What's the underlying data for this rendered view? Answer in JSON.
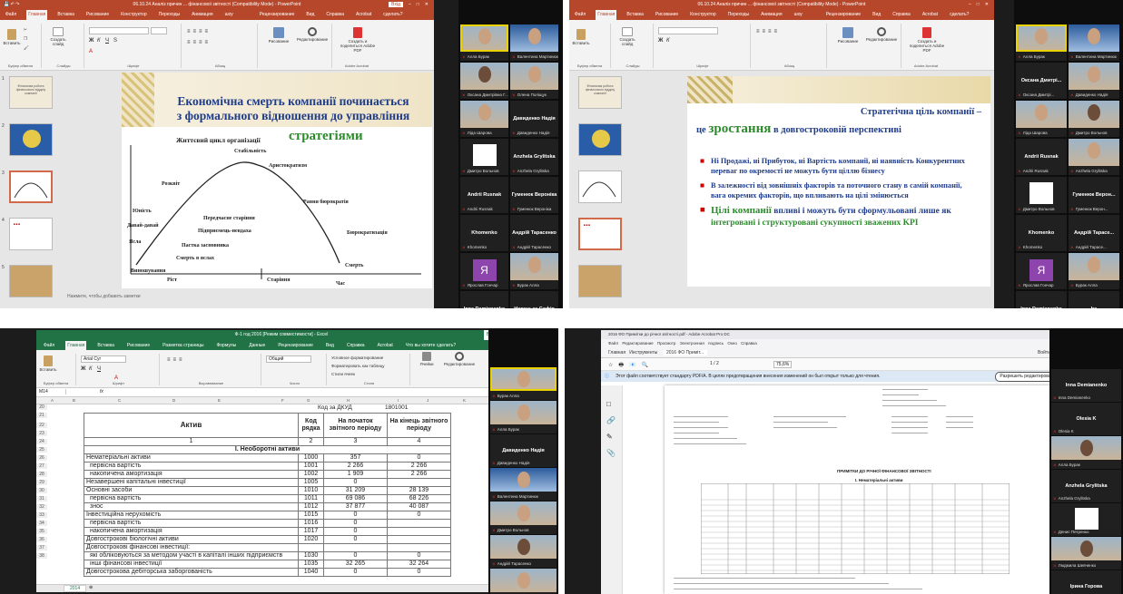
{
  "q1": {
    "title": "06.10.24 Аналіз причин ... фінансової звітності (Compatibility Mode) - PowerPoint",
    "account": "Вхід",
    "tabs": [
      "Файл",
      "Главная",
      "Вставка",
      "Рисование",
      "Конструктор",
      "Переходы",
      "Анимация",
      "Слайд-шоу",
      "Рецензирование",
      "Вид",
      "Справка",
      "Acrobat",
      "Что вы хотите сделать?"
    ],
    "share": "Поделиться",
    "ribbon": {
      "paste": "Вставить",
      "create": "Создать слайд",
      "drawing": "Рисование",
      "editing": "Редактирование",
      "adobe": "Создать и поделиться Adobe PDF",
      "groups": [
        "Буфер обмена",
        "Слайды",
        "Шрифт",
        "Абзац",
        "Adobe Acrobat"
      ]
    },
    "slide": {
      "title_line1": "Економічна смерть компанії починається",
      "title_line2": "з формального відношення до управління",
      "title_emph": "стратегіями",
      "chart_title": "Життєвий цикл організації",
      "labels": {
        "stability": "Стабільність",
        "aristocracy": "Аристократизм",
        "prosperity": "Розквіт",
        "early_bureau": "Рання бюрократія",
        "youth": "Юність",
        "pre_aging": "Передчасне старіння",
        "family_trap": "Підприємець-невдаха",
        "go_go": "Давай-давай",
        "infancy": "Ясла",
        "founder_trap": "Пастка засновника",
        "death_infancy": "Смерть в яслах",
        "bureaucracy": "Бюрократизація",
        "courtship": "Виношування",
        "death": "Смерть",
        "growth": "Ріст",
        "aging": "Старіння",
        "time": "Час"
      }
    },
    "notes": "Нажмите, чтобы добавить заметки",
    "thumb_nums": [
      "1",
      "2",
      "3",
      "4",
      "5"
    ],
    "thumb1": "Фінансова робота фінансового відділу компанії",
    "participants": [
      {
        "name": "Алла Бурак",
        "kind": "photo"
      },
      {
        "name": "Валентина Мартинюк",
        "kind": "photo-blue"
      },
      {
        "name": "Оксана Дмитрівна Г...",
        "kind": "photo"
      },
      {
        "name": "Олена Поліщук",
        "kind": "photo"
      },
      {
        "name": "Ліда Шарова",
        "kind": "photo"
      },
      {
        "name": "Давиденко Надія",
        "kind": "text"
      },
      {
        "name": "Дмитро Вольнов",
        "kind": "white"
      },
      {
        "name": "Anzhela Grylitska",
        "kind": "text"
      },
      {
        "name": "Andrii Rusnak",
        "kind": "text"
      },
      {
        "name": "Гуменюк Вероніка",
        "kind": "text"
      },
      {
        "name": "Khomenko",
        "kind": "text"
      },
      {
        "name": "Андрій Тарасенко",
        "kind": "text"
      },
      {
        "name": "Ярослав Гончар",
        "kind": "yavatar",
        "letter": "Я"
      },
      {
        "name": "Бурак Алла",
        "kind": "photo"
      },
      {
        "name": "Inna Demianenko",
        "kind": "text"
      },
      {
        "name": "Невецька Софія",
        "kind": "text"
      }
    ]
  },
  "q2": {
    "tabs": [
      "Файл",
      "Главная",
      "Вставка",
      "Рисование",
      "Конструктор",
      "Переходы",
      "Анимация",
      "Слайд-шоу",
      "Рецензирование",
      "Вид",
      "Справка",
      "Acrobat",
      "Что вы хотите сделать?"
    ],
    "share": "Поделиться",
    "slide": {
      "title_a": "Стратегічна ціль компанії –",
      "title_b": "це",
      "title_emph": "зростання",
      "title_c": "в довгостроковій перспективі",
      "bullet1": "Ні Продажі, ні Прибуток, ні Вартість компанії, ні наявність Конкурентних переваг по окремості не можуть бути ціллю бізнесу",
      "bullet2": "В залежності від зовнішніх факторів та поточного стану в самій компанії, вага окремих факторів, що впливають на цілі змінюється",
      "bullet3_emph": "Цілі компанії",
      "bullet3_a": "впливі і можуть бути сформульовані лише як",
      "bullet3_emph2": "інтегровані і структуровані сукупності зважених KPI"
    },
    "participants": [
      {
        "name": "Алла Бурак",
        "kind": "photo"
      },
      {
        "name": "Валентина Мартинюк",
        "kind": "photo-blue"
      },
      {
        "name": "Оксана Дмитрі...",
        "kind": "text"
      },
      {
        "name": "Давиденко Надія",
        "kind": "photo"
      },
      {
        "name": "Ліда Шарова",
        "kind": "photo"
      },
      {
        "name": "Дмитро Вольнов",
        "kind": "photo"
      },
      {
        "name": "Andrii Rusnak",
        "kind": "text"
      },
      {
        "name": "Anzhela Grylitska",
        "kind": "photo"
      },
      {
        "name": "Дмитро Вольнов",
        "kind": "white"
      },
      {
        "name": "Гуменюк Верон...",
        "kind": "text"
      },
      {
        "name": "Khomenko",
        "kind": "text"
      },
      {
        "name": "Андрій Тарасе...",
        "kind": "text"
      },
      {
        "name": "Ярослав Гончар",
        "kind": "yavatar",
        "letter": "Я"
      },
      {
        "name": "Бурак Алла",
        "kind": "photo"
      },
      {
        "name": "Inna Demianenko",
        "kind": "text"
      },
      {
        "name": "Ira",
        "kind": "text"
      }
    ]
  },
  "q3": {
    "title": "Ф-1 год 2016 [Режим совместимости] - Excel",
    "account": "Вход",
    "tabs": [
      "Файл",
      "Главная",
      "Вставка",
      "Рисование",
      "Разметка страницы",
      "Формулы",
      "Данные",
      "Рецензирование",
      "Вид",
      "Справка",
      "Acrobat",
      "Что вы хотите сделать?"
    ],
    "cellref": "M14",
    "fx": "fx",
    "font": "Arial Cyr",
    "numfmt": "Общий",
    "ribbon": {
      "paste": "Вставить",
      "cond": "Условное форматирование",
      "astable": "Форматировать как таблицу",
      "styles": "Стили ячеек",
      "cells": "Ячейки",
      "editing": "Редактирование",
      "groups": [
        "Буфер обмена",
        "Шрифт",
        "Выравнивание",
        "Число",
        "Стили"
      ]
    },
    "col_letters": [
      "A",
      "B",
      "C",
      "D",
      "E",
      "F",
      "G",
      "H",
      "I",
      "J",
      "K",
      "L"
    ],
    "code_dkud_label": "Код за ДКУД",
    "code_dkud": "1801001",
    "headers": [
      "Актив",
      "Код рядка",
      "На початок звітного періоду",
      "На кінець звітного періоду"
    ],
    "index_row": [
      "1",
      "2",
      "3",
      "4"
    ],
    "section": "I. Необоротні активи",
    "rows": [
      {
        "rn": "24",
        "name": "Нематеріальні активи",
        "code": "1000",
        "start": "357",
        "end": "0"
      },
      {
        "rn": "25",
        "name": "первісна вартість",
        "code": "1001",
        "start": "2 266",
        "end": "2 266"
      },
      {
        "rn": "26",
        "name": "накопичена амортизація",
        "code": "1002",
        "start": "1 909",
        "end": "2 266"
      },
      {
        "rn": "27",
        "name": "Незавершені капітальні інвестиції",
        "code": "1005",
        "start": "0",
        "end": ""
      },
      {
        "rn": "28",
        "name": "Основні засоби",
        "code": "1010",
        "start": "31 209",
        "end": "28 139"
      },
      {
        "rn": "29",
        "name": "первісна вартість",
        "code": "1011",
        "start": "69 086",
        "end": "68 226"
      },
      {
        "rn": "30",
        "name": "знос",
        "code": "1012",
        "start": "37 877",
        "end": "40 087"
      },
      {
        "rn": "31",
        "name": "Інвестиційна нерухомість",
        "code": "1015",
        "start": "0",
        "end": "0"
      },
      {
        "rn": "32",
        "name": "первісна вартість",
        "code": "1016",
        "start": "0",
        "end": ""
      },
      {
        "rn": "33",
        "name": "накопичена амортизація",
        "code": "1017",
        "start": "0",
        "end": ""
      },
      {
        "rn": "34",
        "name": "Довгострокові біологічні активи",
        "code": "1020",
        "start": "0",
        "end": ""
      },
      {
        "rn": "35",
        "name": "Довгострокові фінансові інвестиції:",
        "code": "",
        "start": "",
        "end": ""
      },
      {
        "rn": "36",
        "name": "які обліковуються за методом участі в капіталі інших підприємств",
        "code": "1030",
        "start": "0",
        "end": "0"
      },
      {
        "rn": "37",
        "name": "інші фінансові інвестиції",
        "code": "1035",
        "start": "32 265",
        "end": "32 264"
      },
      {
        "rn": "38",
        "name": "Довгострокова дебіторська заборгованість",
        "code": "1040",
        "start": "0",
        "end": "0"
      }
    ],
    "row_nums_top": [
      "20",
      "21",
      "22",
      "23"
    ],
    "sheet_tab": "2014",
    "participants": [
      {
        "name": "Бурак Алла",
        "kind": "photo"
      },
      {
        "name": "Алла Бурак",
        "kind": "photo"
      },
      {
        "name": "Давиденко Надія",
        "kind": "text"
      },
      {
        "name": "Валентина Мартинюк",
        "kind": "photo-blue"
      },
      {
        "name": "Дмитро Вольнов",
        "kind": "photo"
      },
      {
        "name": "Андрій Тарасенко",
        "kind": "photo"
      },
      {
        "name": "Ольга Фадеєва",
        "kind": "photo"
      }
    ]
  },
  "q4": {
    "title": "2016 ФО Примітки до річної звітності.pdf - Adobe Acrobat Pro DC",
    "menu": "Файл Редактирование Просмотр Электронная подпись Окно Справка",
    "tabs": [
      "Главная",
      "Инструменты",
      "2016 ФО Приміт..."
    ],
    "signin": "Войти",
    "page_of": "1 / 2",
    "zoom": "75,6%",
    "notice": "Этот файл соответствует стандарту PDF/A. В целях предотвращения внесения изменений он был открыт только для чтения.",
    "enable_edit": "Разрешить редактирование",
    "form_title": "ПРИМІТКИ ДО РІЧНОЇ ФІНАНСОВОЇ ЗВІТНОСТІ",
    "form_section": "I. Нематеріальні активи",
    "participants": [
      {
        "name": "Inna Demianenko",
        "kind": "text"
      },
      {
        "name": "Olesia K",
        "kind": "text"
      },
      {
        "name": "Алла Бурак",
        "kind": "photo"
      },
      {
        "name": "Anzhela Grylitska",
        "kind": "text"
      },
      {
        "name": "Денис Петренко",
        "kind": "white"
      },
      {
        "name": "Людмила Шевченко",
        "kind": "photo"
      },
      {
        "name": "Ірина Горова",
        "kind": "text"
      }
    ]
  }
}
